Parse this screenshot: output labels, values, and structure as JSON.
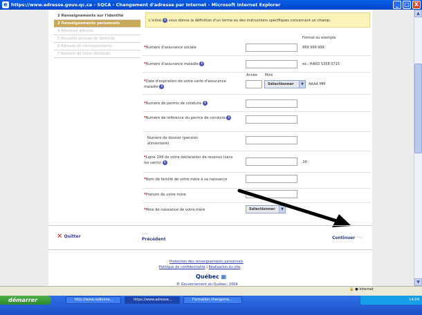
{
  "window": {
    "title": "https://www.adresse.gouv.qc.ca - SQCA - Changement d'adresse par Internet - Microsoft Internet Explorer",
    "min": "_",
    "max": "□",
    "close": "X"
  },
  "sidebar": {
    "items": [
      {
        "label": "2 Renseignements sur l'identité",
        "state": "done"
      },
      {
        "label": "3 Renseignements personnels",
        "state": "current"
      },
      {
        "label": "4 Ancienne adresse",
        "state": "disabled"
      },
      {
        "label": "5 Nouvelle adresse de domicile",
        "state": "disabled"
      },
      {
        "label": "6 Adresse de correspondance",
        "state": "disabled"
      },
      {
        "label": "7 Résumé de votre demande",
        "state": "disabled"
      }
    ]
  },
  "notice": {
    "before": "L'icône",
    "after": "vous donne la définition d'un terme ou des instructions spécifiques concernant un champ."
  },
  "format_header": "Format ou exemple",
  "date_headers": {
    "year": "Année",
    "month": "Mois"
  },
  "fields": {
    "nas": {
      "label": "Numéro d'assurance sociale",
      "example": "999 999 999"
    },
    "ram": {
      "label": "Numéro d'assurance maladie",
      "example": "ex.: HARD 5358 0715"
    },
    "ram_exp": {
      "label": "Date d'expiration de votre carte d'assurance maladie",
      "select": "Sélectionner",
      "example": "AAAA MM"
    },
    "permis": {
      "label": "Numéro de permis de conduire"
    },
    "permis_ref": {
      "label": "Numéro de référence du permis de conduire"
    },
    "dossier": {
      "label": "Numéro de dossier (pension alimentaire)"
    },
    "revenus": {
      "label": "Ligne 199 de votre déclaration de revenus (sans les cents)",
      "suffix": ",00"
    },
    "nom_mere": {
      "label": "Nom de famille de votre mère à sa naissance"
    },
    "prenom_mere": {
      "label": "Prénom de votre mère"
    },
    "mois_mere": {
      "label": "Mois de naissance de votre mère",
      "select": "Sélectionner"
    }
  },
  "nav": {
    "quit": "Quitter",
    "previous": "Précédent",
    "next": "Continuer"
  },
  "footer": {
    "link1": "Protection des renseignements personnels",
    "link2": "Politique de confidentialité",
    "link3": "Réalisation du site",
    "brand": "Québec",
    "copyright": "Gouvernement du Québec, 2004"
  },
  "status": {
    "zone": "Internet"
  },
  "taskbar": {
    "start": "démarrer",
    "tasks": [
      "http://www.radioone...",
      "https://www.adresse...",
      "Formation changeme..."
    ],
    "clock": "14:04"
  }
}
